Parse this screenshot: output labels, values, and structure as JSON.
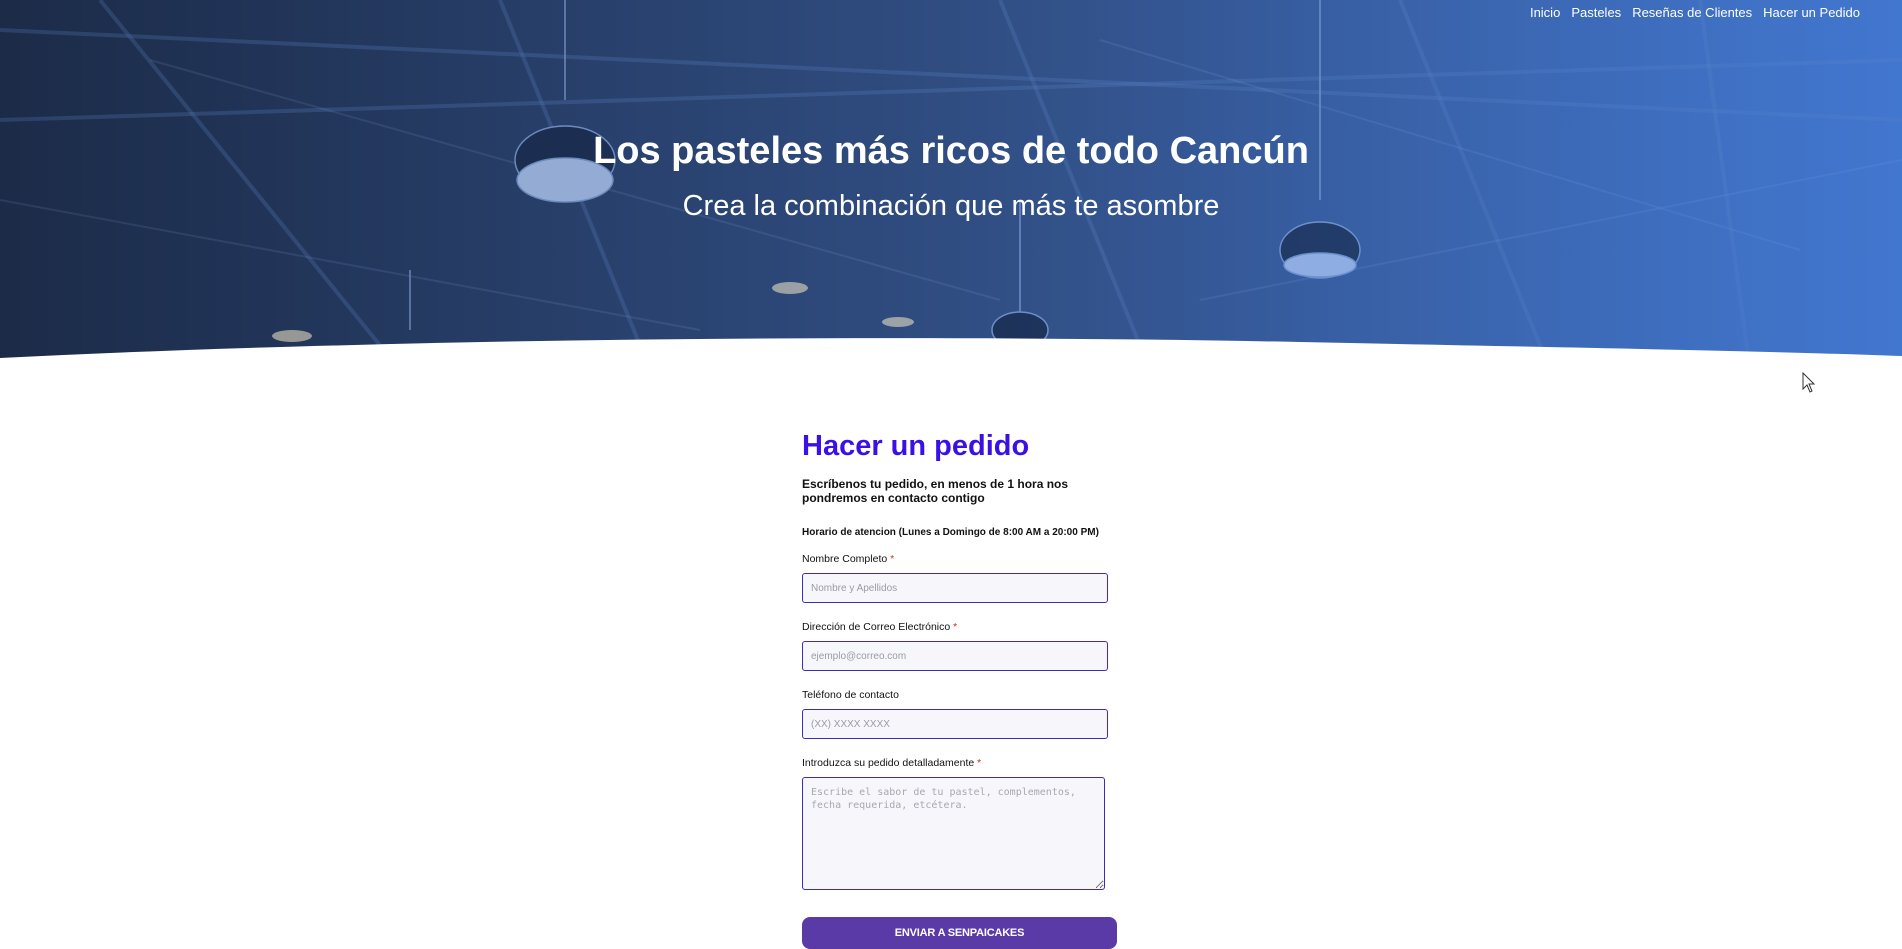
{
  "nav": {
    "items": [
      {
        "label": "Inicio"
      },
      {
        "label": "Pasteles"
      },
      {
        "label": "Reseñas de Clientes"
      },
      {
        "label": "Hacer un Pedido"
      }
    ]
  },
  "hero": {
    "title": "Los pasteles más ricos de todo Cancún",
    "subtitle": "Crea la combinación que más te asombre"
  },
  "form": {
    "title": "Hacer un pedido",
    "intro": "Escríbenos tu pedido, en menos de 1 hora nos pondremos en contacto contigo",
    "hours": "Horario de atencion (Lunes a Domingo de 8:00 AM a 20:00 PM)",
    "name_label": "Nombre Completo",
    "name_placeholder": "Nombre y Apellidos",
    "email_label": "Dirección de Correo Electrónico",
    "email_placeholder": "ejemplo@correo.com",
    "phone_label": "Teléfono de contacto",
    "phone_placeholder": "(XX) XXXX XXXX",
    "order_label": "Introduzca su pedido detalladamente",
    "order_placeholder": "Escribe el sabor de tu pastel, complementos, fecha requerida, etcétera.",
    "required_mark": "*",
    "submit_label": "ENVIAR A SENPAICAKES"
  },
  "colors": {
    "accent": "#3a10e5",
    "button": "#5a3aa6",
    "field_border": "#3b2db8",
    "required": "#c0392b"
  },
  "icons": {
    "cursor": "mouse-pointer-icon"
  }
}
